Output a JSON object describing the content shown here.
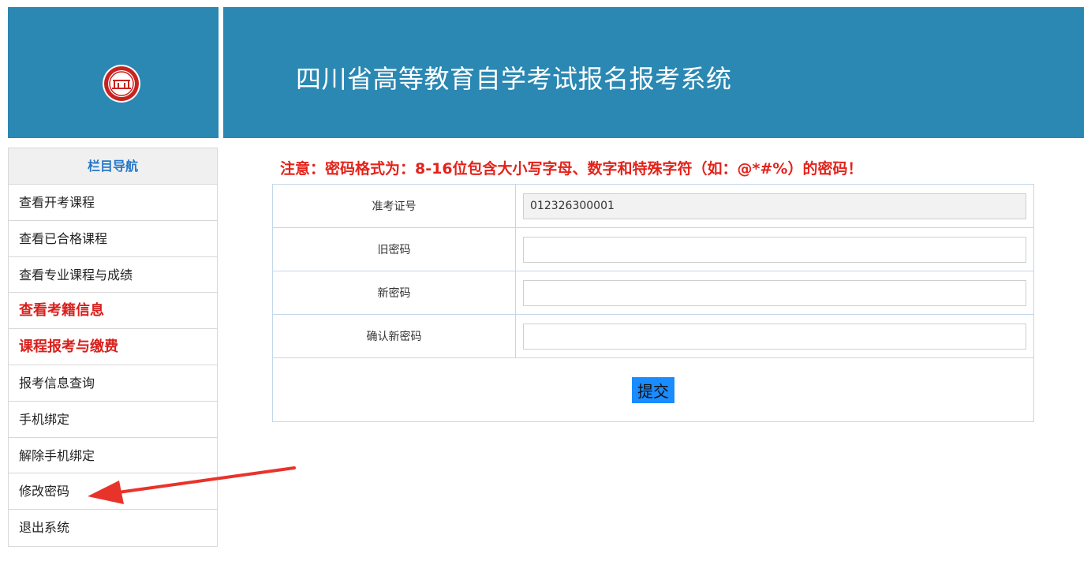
{
  "header": {
    "title": "四川省高等教育自学考试报名报考系统",
    "logo_icon": "school-seal-icon"
  },
  "sidebar": {
    "header": "栏目导航",
    "items": [
      {
        "label": "查看开考课程"
      },
      {
        "label": "查看已合格课程"
      },
      {
        "label": "查看专业课程与成绩"
      },
      {
        "label": "查看考籍信息"
      },
      {
        "label": "课程报考与缴费"
      },
      {
        "label": "报考信息查询"
      },
      {
        "label": "手机绑定"
      },
      {
        "label": "解除手机绑定"
      },
      {
        "label": "修改密码"
      },
      {
        "label": "退出系统"
      }
    ]
  },
  "main": {
    "notice": "注意：密码格式为：8-16位包含大小写字母、数字和特殊字符（如：@*#%）的密码！",
    "form": {
      "exam_id_label": "准考证号",
      "exam_id_value": "012326300001",
      "old_password_label": "旧密码",
      "old_password_value": "",
      "new_password_label": "新密码",
      "new_password_value": "",
      "confirm_password_label": "确认新密码",
      "confirm_password_value": "",
      "submit_label": "提交"
    }
  },
  "colors": {
    "header_bg": "#2a88b3",
    "nav_header_text": "#2577c8",
    "notice_red": "#e3231b",
    "submit_bg": "#1a8cff",
    "arrow_red": "#e8332b"
  }
}
